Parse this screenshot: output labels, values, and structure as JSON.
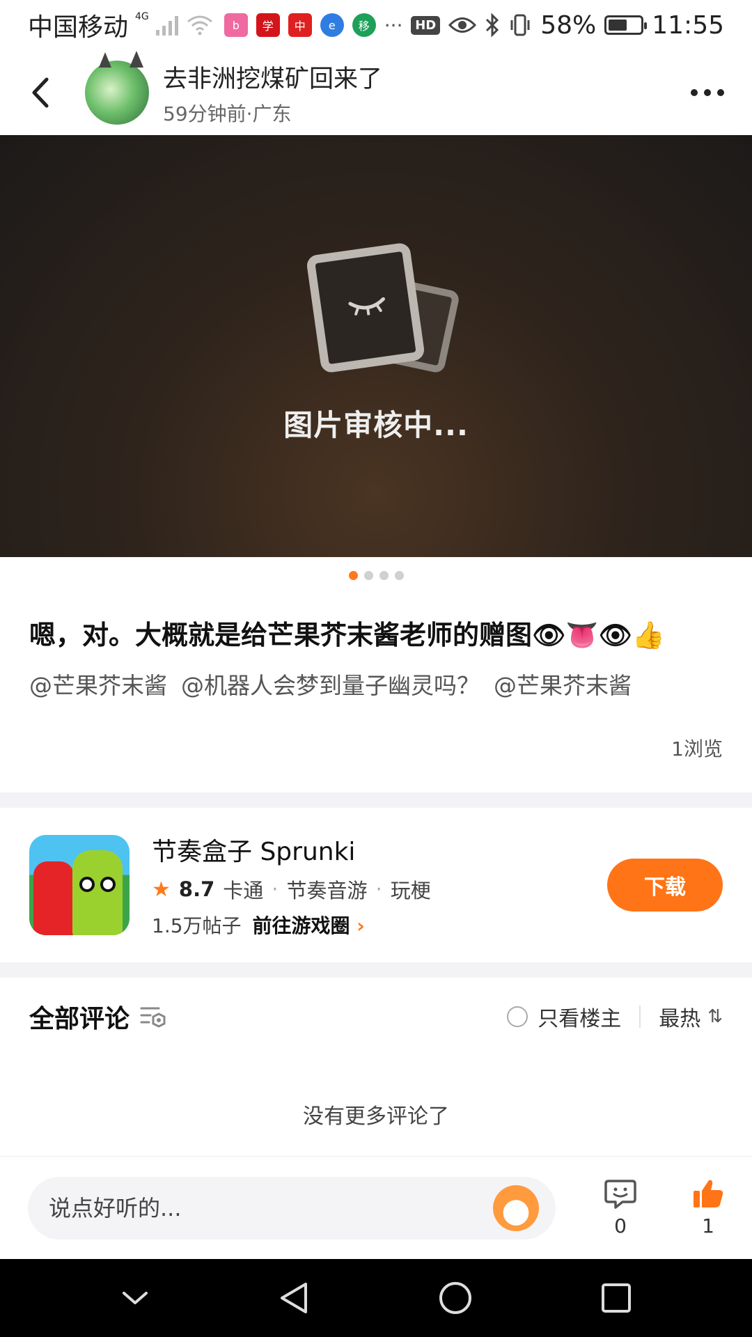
{
  "status_bar": {
    "carrier": "中国移动",
    "network": "4G",
    "battery": "58%",
    "battery_level": 0.58,
    "time": "11:55",
    "hd": "HD",
    "more": "···",
    "app_icons": [
      "bilibili-icon",
      "xuexi-icon",
      "unionpay-icon",
      "browser-icon",
      "chinamobile-icon"
    ]
  },
  "header": {
    "author_name": "去非洲挖煤矿回来了",
    "post_meta": "59分钟前·广东"
  },
  "media": {
    "review_text": "图片审核中...",
    "page_count": 4,
    "active_index": 0
  },
  "post": {
    "title": "嗯，对。大概就是给芒果芥末酱老师的赠图👁👅👁👍",
    "mentions": [
      "@芒果芥末酱",
      "@机器人会梦到量子幽灵吗？",
      "@芒果芥末酱"
    ],
    "views": "1浏览"
  },
  "game_card": {
    "name": "节奏盒子 Sprunki",
    "rating": "8.7",
    "tags": [
      "卡通",
      "节奏音游",
      "玩梗"
    ],
    "posts": "1.5万帖子",
    "goto_label": "前往游戏圈",
    "download_label": "下载"
  },
  "comments": {
    "title": "全部评论",
    "only_op_label": "只看楼主",
    "sort_label": "最热",
    "empty_text": "没有更多评论了"
  },
  "bottom_bar": {
    "input_placeholder": "说点好听的...",
    "comment_count": "0",
    "like_count": "1"
  },
  "colors": {
    "accent": "#ff7416",
    "media_bg": "#2f241c"
  }
}
